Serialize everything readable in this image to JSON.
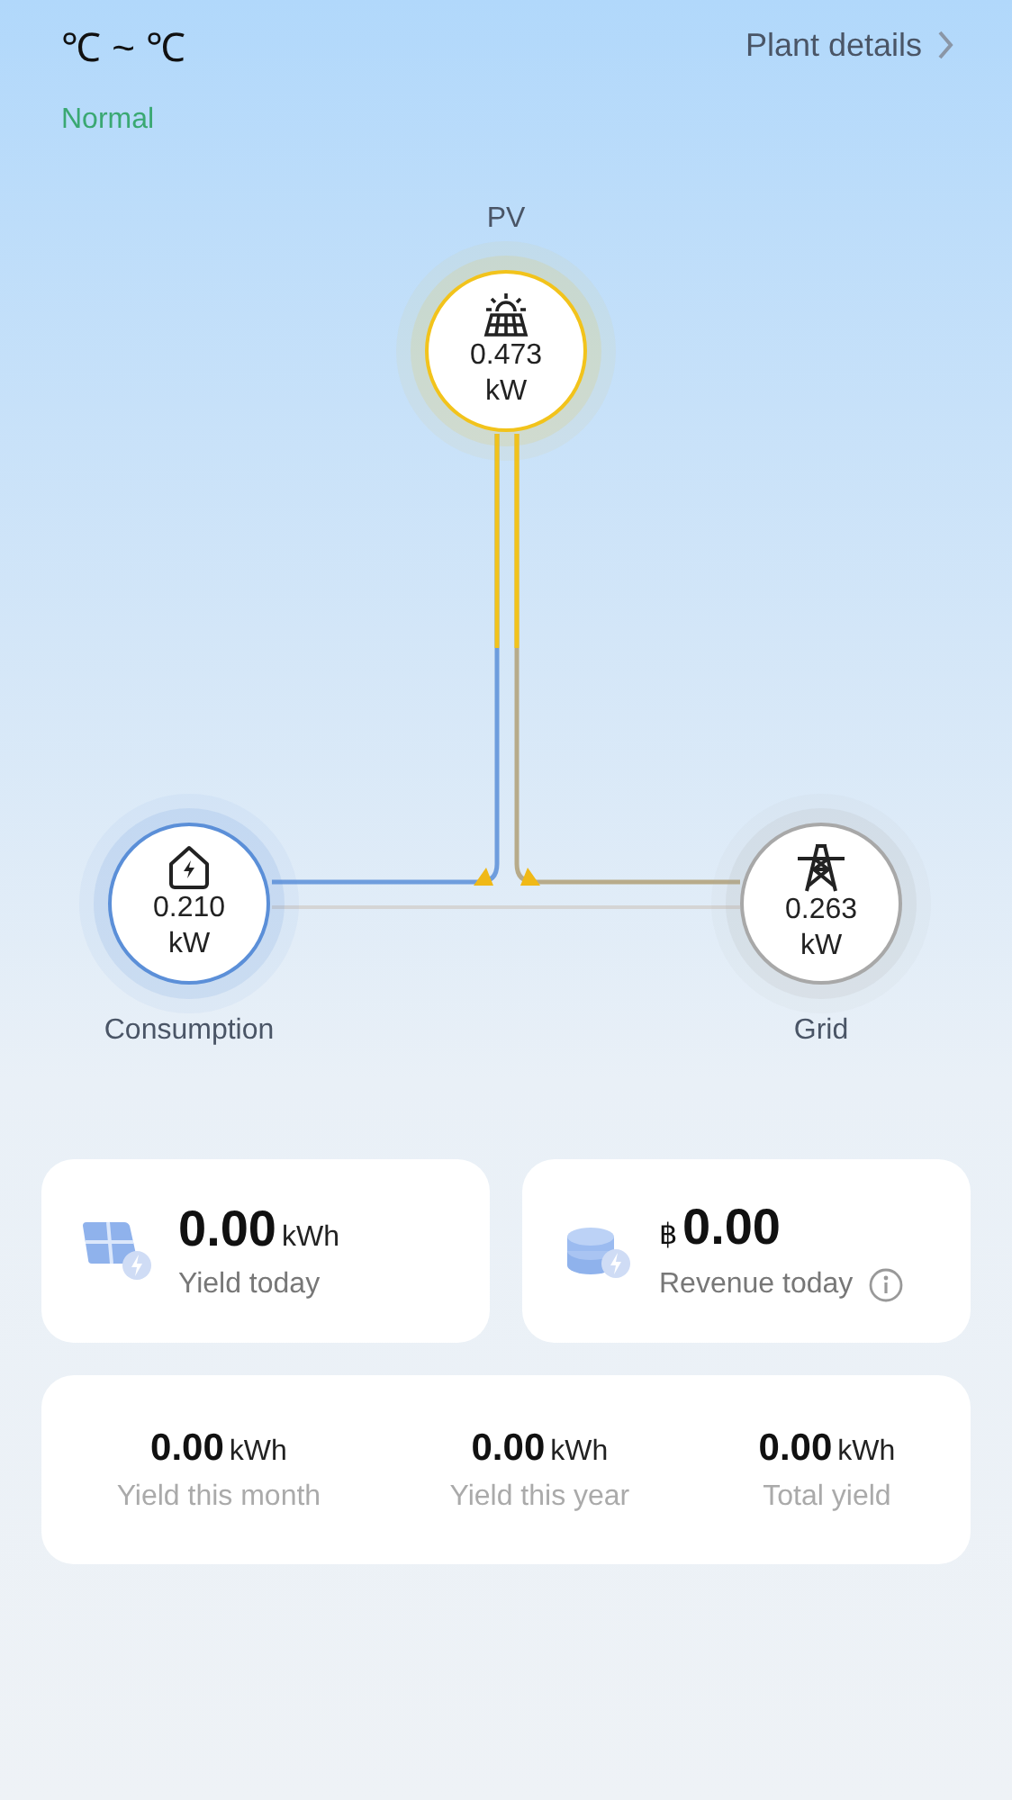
{
  "header": {
    "temperature": "℃ ~ ℃",
    "link": "Plant details",
    "status": "Normal"
  },
  "nodes": [
    {
      "kind": "pv",
      "label": "PV",
      "value": "0.473",
      "unit": "kW",
      "color": "#f2c31b"
    },
    {
      "kind": "consumption",
      "label": "Consumption",
      "value": "0.210",
      "unit": "kW",
      "color": "#5b8fd8"
    },
    {
      "kind": "grid",
      "label": "Grid",
      "value": "0.263",
      "unit": "kW",
      "color": "#a8a8a8"
    }
  ],
  "summary_cards": [
    {
      "kind": "yield",
      "value": "0.00",
      "unit": "kWh",
      "label": "Yield today"
    },
    {
      "kind": "revenue",
      "currency": "฿",
      "value": "0.00",
      "label": "Revenue today",
      "info": true
    }
  ],
  "totals": [
    {
      "value": "0.00",
      "unit": "kWh",
      "label": "Yield this month"
    },
    {
      "value": "0.00",
      "unit": "kWh",
      "label": "Yield this year"
    },
    {
      "value": "0.00",
      "unit": "kWh",
      "label": "Total yield"
    }
  ]
}
